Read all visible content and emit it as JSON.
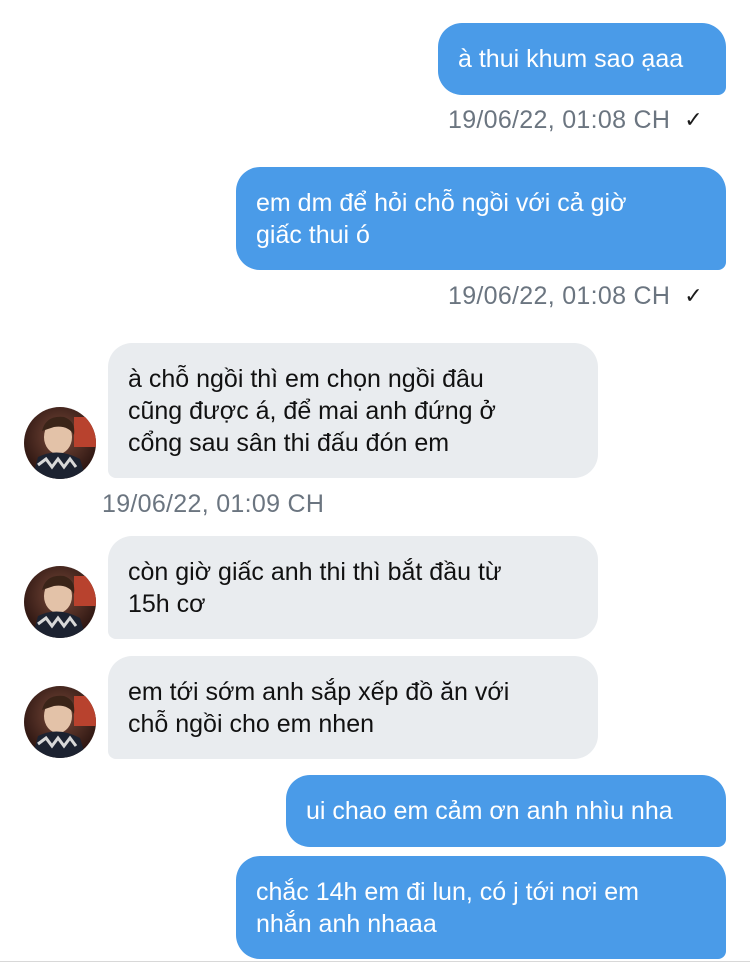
{
  "messages": [
    {
      "id": "m1",
      "side": "sent",
      "text": "à thui khum sao ạaa"
    },
    {
      "id": "m2",
      "side": "sent",
      "text": "em dm để hỏi chỗ ngồi với cả giờ\ngiấc thui ó"
    },
    {
      "id": "m3",
      "side": "received",
      "text": "à chỗ ngồi thì em chọn ngồi đâu\ncũng được á, để mai anh đứng ở\ncổng sau sân thi đấu đón em"
    },
    {
      "id": "m4",
      "side": "received",
      "text": "còn giờ giấc anh thi thì bắt đầu từ\n15h cơ"
    },
    {
      "id": "m5",
      "side": "received",
      "text": "em tới sớm anh sắp xếp đồ ăn với\nchỗ ngồi cho em nhen"
    },
    {
      "id": "m6",
      "side": "sent",
      "text": "ui chao em cảm ơn anh nhìu nha"
    },
    {
      "id": "m7",
      "side": "sent",
      "text": "chắc 14h em đi lun, có j tới nơi em\nnhắn anh nhaaa"
    }
  ],
  "timestamps": {
    "t1": "19/06/22, 01:08 CH",
    "t2": "19/06/22, 01:08 CH",
    "t3": "19/06/22, 01:09 CH"
  },
  "read_mark": "✓",
  "colors": {
    "sent_bubble": "#4a9be8",
    "received_bubble": "#e9ecef",
    "timestamp_text": "#6b7580"
  }
}
